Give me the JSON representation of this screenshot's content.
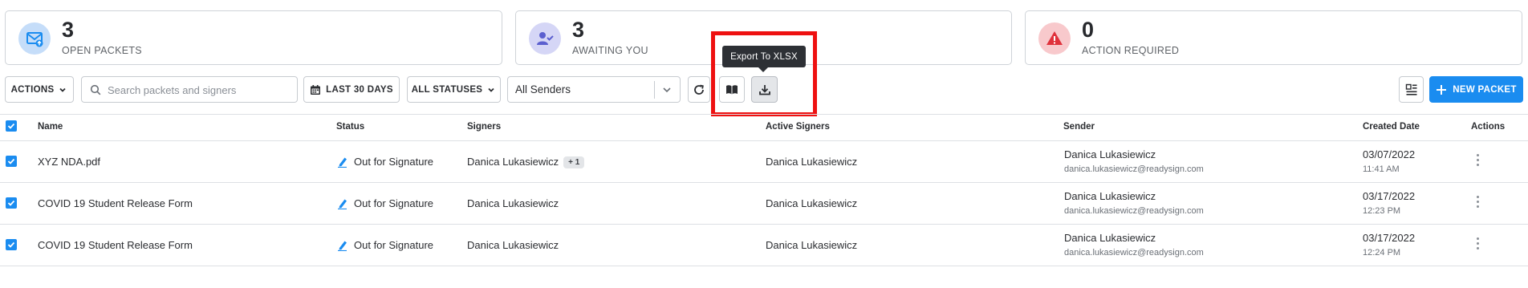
{
  "stats": [
    {
      "count": "3",
      "label": "OPEN PACKETS",
      "icon": "mail-upload-icon",
      "color": "#1a8cf0"
    },
    {
      "count": "3",
      "label": "AWAITING YOU",
      "icon": "user-check-icon",
      "color": "#5b5fcf"
    },
    {
      "count": "0",
      "label": "ACTION REQUIRED",
      "icon": "warning-triangle-icon",
      "color": "#e0323c"
    }
  ],
  "toolbar": {
    "actions_label": "ACTIONS",
    "search_placeholder": "Search packets and signers",
    "date_label": "LAST 30 DAYS",
    "status_label": "ALL STATUSES",
    "senders_value": "All Senders",
    "tooltip": "Export To XLSX",
    "new_packet_label": "NEW PACKET"
  },
  "table": {
    "headers": {
      "name": "Name",
      "status": "Status",
      "signers": "Signers",
      "active_signers": "Active Signers",
      "sender": "Sender",
      "created_date": "Created Date",
      "actions": "Actions"
    },
    "rows": [
      {
        "name": "XYZ NDA.pdf",
        "status": "Out for Signature",
        "signers": "Danica Lukasiewicz",
        "signers_extra": "+ 1",
        "active_signers": "Danica Lukasiewicz",
        "sender_name": "Danica Lukasiewicz",
        "sender_email": "danica.lukasiewicz@readysign.com",
        "date": "03/07/2022",
        "time": "11:41 AM"
      },
      {
        "name": "COVID 19 Student Release Form",
        "status": "Out for Signature",
        "signers": "Danica Lukasiewicz",
        "signers_extra": "",
        "active_signers": "Danica Lukasiewicz",
        "sender_name": "Danica Lukasiewicz",
        "sender_email": "danica.lukasiewicz@readysign.com",
        "date": "03/17/2022",
        "time": "12:23 PM"
      },
      {
        "name": "COVID 19 Student Release Form",
        "status": "Out for Signature",
        "signers": "Danica Lukasiewicz",
        "signers_extra": "",
        "active_signers": "Danica Lukasiewicz",
        "sender_name": "Danica Lukasiewicz",
        "sender_email": "danica.lukasiewicz@readysign.com",
        "date": "03/17/2022",
        "time": "12:24 PM"
      }
    ]
  },
  "colors": {
    "accent": "#1a8cf0",
    "highlight": "#ee1111"
  }
}
